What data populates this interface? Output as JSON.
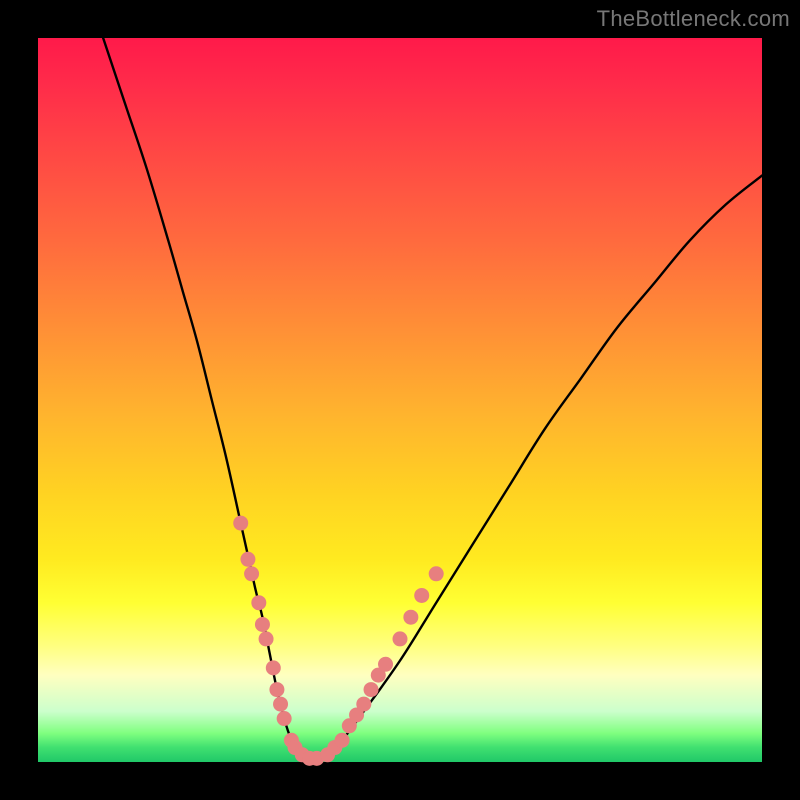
{
  "watermark": "TheBottleneck.com",
  "chart_data": {
    "type": "line",
    "title": "",
    "xlabel": "",
    "ylabel": "",
    "xlim": [
      0,
      100
    ],
    "ylim": [
      0,
      100
    ],
    "series": [
      {
        "name": "bottleneck-curve",
        "x": [
          9,
          12,
          15,
          18,
          20,
          22,
          24,
          26,
          28,
          30,
          31,
          32,
          33,
          34,
          35,
          36,
          37,
          38,
          40,
          42,
          45,
          50,
          55,
          60,
          65,
          70,
          75,
          80,
          85,
          90,
          95,
          100
        ],
        "y": [
          100,
          91,
          82,
          72,
          65,
          58,
          50,
          42,
          33,
          24,
          20,
          15,
          10,
          6,
          3,
          1,
          0.5,
          0.5,
          1,
          3,
          7,
          14,
          22,
          30,
          38,
          46,
          53,
          60,
          66,
          72,
          77,
          81
        ]
      }
    ],
    "markers": {
      "name": "highlight-dots",
      "color": "#e77f7f",
      "points": [
        {
          "x": 28.0,
          "y": 33
        },
        {
          "x": 29.0,
          "y": 28
        },
        {
          "x": 29.5,
          "y": 26
        },
        {
          "x": 30.5,
          "y": 22
        },
        {
          "x": 31.0,
          "y": 19
        },
        {
          "x": 31.5,
          "y": 17
        },
        {
          "x": 32.5,
          "y": 13
        },
        {
          "x": 33.0,
          "y": 10
        },
        {
          "x": 33.5,
          "y": 8
        },
        {
          "x": 34.0,
          "y": 6
        },
        {
          "x": 35.0,
          "y": 3
        },
        {
          "x": 35.5,
          "y": 2
        },
        {
          "x": 36.5,
          "y": 1
        },
        {
          "x": 37.5,
          "y": 0.5
        },
        {
          "x": 38.5,
          "y": 0.5
        },
        {
          "x": 40.0,
          "y": 1
        },
        {
          "x": 41.0,
          "y": 2
        },
        {
          "x": 42.0,
          "y": 3
        },
        {
          "x": 43.0,
          "y": 5
        },
        {
          "x": 44.0,
          "y": 6.5
        },
        {
          "x": 45.0,
          "y": 8
        },
        {
          "x": 46.0,
          "y": 10
        },
        {
          "x": 47.0,
          "y": 12
        },
        {
          "x": 48.0,
          "y": 13.5
        },
        {
          "x": 50.0,
          "y": 17
        },
        {
          "x": 51.5,
          "y": 20
        },
        {
          "x": 53.0,
          "y": 23
        },
        {
          "x": 55.0,
          "y": 26
        }
      ]
    },
    "gradient_stops": [
      {
        "pos": 0,
        "color": "#ff1a4a"
      },
      {
        "pos": 15,
        "color": "#ff4545"
      },
      {
        "pos": 40,
        "color": "#ff8f36"
      },
      {
        "pos": 63,
        "color": "#ffd322"
      },
      {
        "pos": 84,
        "color": "#ffff80"
      },
      {
        "pos": 96,
        "color": "#80ff80"
      },
      {
        "pos": 100,
        "color": "#20c868"
      }
    ]
  }
}
